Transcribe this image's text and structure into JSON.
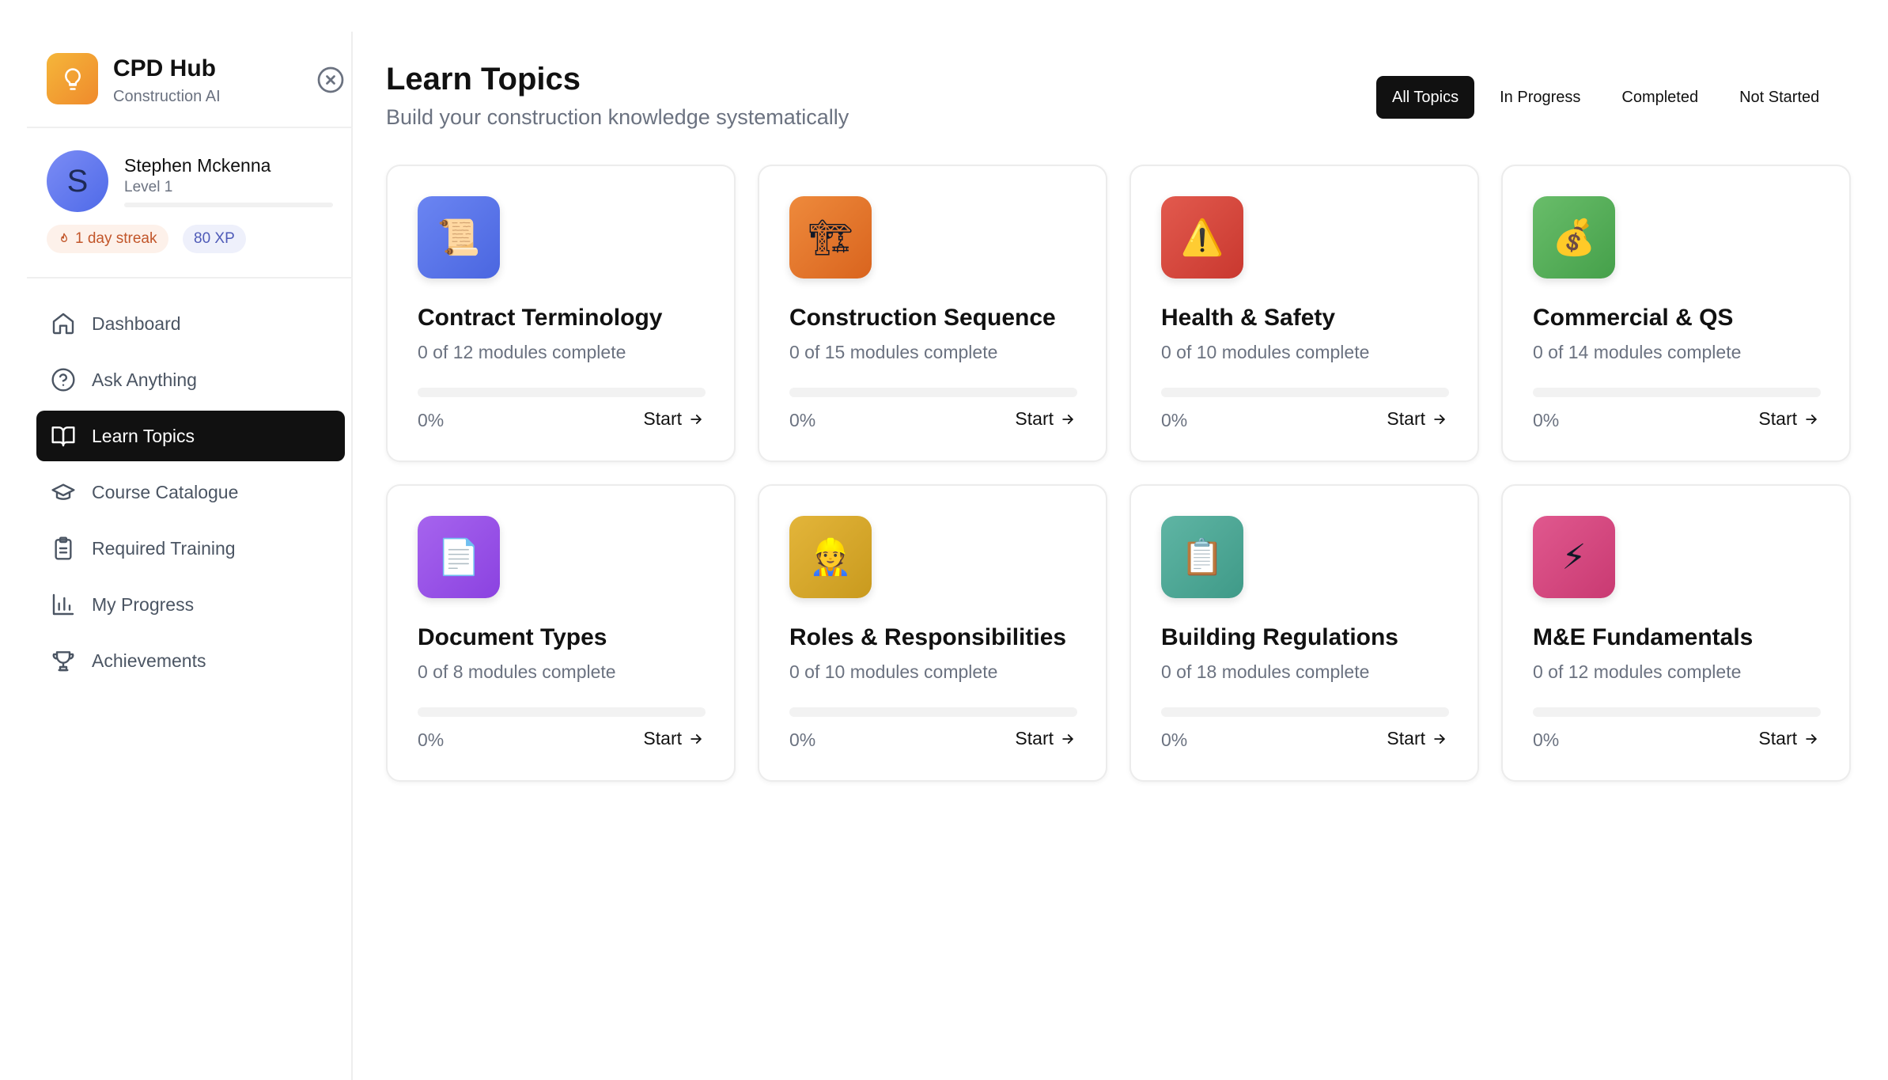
{
  "brand": {
    "name": "CPD Hub",
    "subtitle": "Construction AI"
  },
  "user": {
    "name": "Stephen Mckenna",
    "initial": "S",
    "level": "Level 1",
    "level_progress": 0,
    "streak": "1 day streak",
    "xp": "80 XP"
  },
  "nav": [
    {
      "label": "Dashboard",
      "icon": "home-icon",
      "active": false
    },
    {
      "label": "Ask Anything",
      "icon": "help-circle-icon",
      "active": false
    },
    {
      "label": "Learn Topics",
      "icon": "book-open-icon",
      "active": true
    },
    {
      "label": "Course Catalogue",
      "icon": "graduation-cap-icon",
      "active": false
    },
    {
      "label": "Required Training",
      "icon": "clipboard-icon",
      "active": false
    },
    {
      "label": "My Progress",
      "icon": "bar-chart-icon",
      "active": false
    },
    {
      "label": "Achievements",
      "icon": "trophy-icon",
      "active": false
    }
  ],
  "page": {
    "title": "Learn Topics",
    "subtitle": "Build your construction knowledge systematically"
  },
  "filters": [
    {
      "label": "All Topics",
      "active": true
    },
    {
      "label": "In Progress",
      "active": false
    },
    {
      "label": "Completed",
      "active": false
    },
    {
      "label": "Not Started",
      "active": false
    }
  ],
  "topics": [
    {
      "title": "Contract Terminology",
      "progress_text": "0 of 12 modules complete",
      "percent": "0%",
      "progress": 0,
      "action": "Start",
      "icon": "scroll-icon",
      "glyph": "📜",
      "color_from": "#6b85f2",
      "color_to": "#4a66e0"
    },
    {
      "title": "Construction Sequence",
      "progress_text": "0 of 15 modules complete",
      "percent": "0%",
      "progress": 0,
      "action": "Start",
      "icon": "crane-icon",
      "glyph": "🏗",
      "color_from": "#ee8a3c",
      "color_to": "#d9641e"
    },
    {
      "title": "Health & Safety",
      "progress_text": "0 of 10 modules complete",
      "percent": "0%",
      "progress": 0,
      "action": "Start",
      "icon": "warning-icon",
      "glyph": "⚠️",
      "color_from": "#e25a4e",
      "color_to": "#c9382f"
    },
    {
      "title": "Commercial & QS",
      "progress_text": "0 of 14 modules complete",
      "percent": "0%",
      "progress": 0,
      "action": "Start",
      "icon": "money-bag-icon",
      "glyph": "💰",
      "color_from": "#69bd6a",
      "color_to": "#45a04a"
    },
    {
      "title": "Document Types",
      "progress_text": "0 of 8 modules complete",
      "percent": "0%",
      "progress": 0,
      "action": "Start",
      "icon": "document-icon",
      "glyph": "📄",
      "color_from": "#a664ee",
      "color_to": "#8b42e0"
    },
    {
      "title": "Roles & Responsibilities",
      "progress_text": "0 of 10 modules complete",
      "percent": "0%",
      "progress": 0,
      "action": "Start",
      "icon": "worker-icon",
      "glyph": "👷",
      "color_from": "#e3b53a",
      "color_to": "#c99a1e"
    },
    {
      "title": "Building Regulations",
      "progress_text": "0 of 18 modules complete",
      "percent": "0%",
      "progress": 0,
      "action": "Start",
      "icon": "clipboard-icon",
      "glyph": "📋",
      "color_from": "#5fb5a4",
      "color_to": "#3f9a88"
    },
    {
      "title": "M&E Fundamentals",
      "progress_text": "0 of 12 modules complete",
      "percent": "0%",
      "progress": 0,
      "action": "Start",
      "icon": "lightning-icon",
      "glyph": "⚡",
      "color_from": "#e0588e",
      "color_to": "#c93a72"
    }
  ]
}
